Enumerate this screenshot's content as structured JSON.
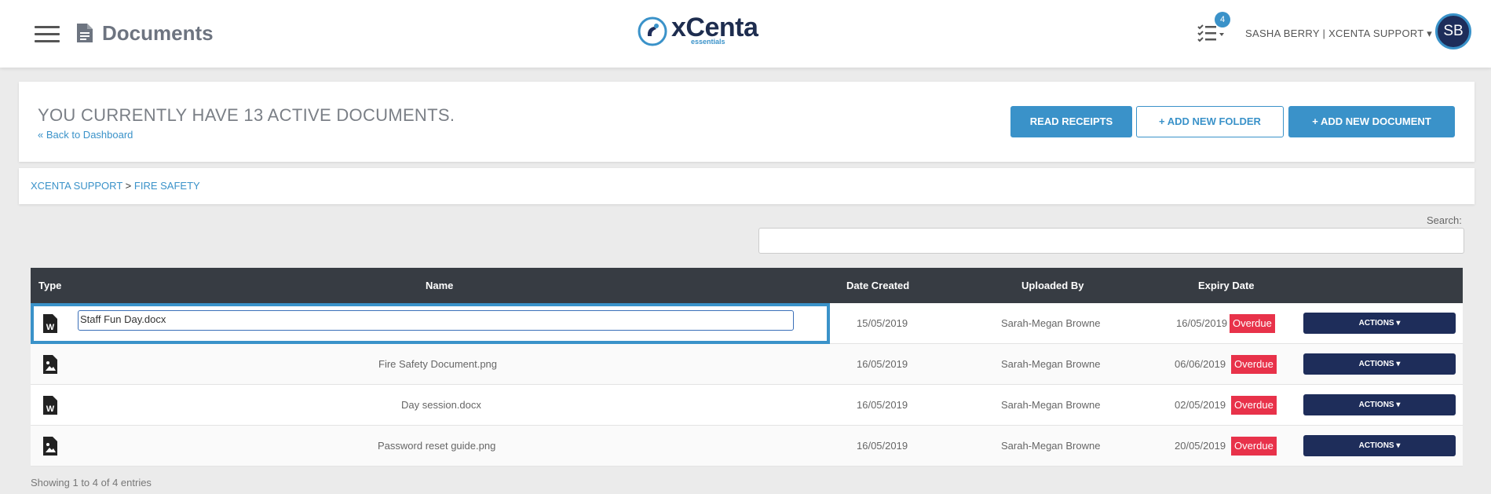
{
  "header": {
    "page_title": "Documents",
    "logo_text": "xCenta",
    "logo_sub": "essentials",
    "task_badge": "4",
    "user_menu": "SASHA BERRY | XCENTA SUPPORT ▾",
    "avatar_initials": "SB"
  },
  "summary": {
    "headline": "YOU CURRENTLY HAVE 13 ACTIVE DOCUMENTS.",
    "back_link": "« Back to Dashboard",
    "read_receipts": "READ RECEIPTS",
    "add_folder": "+ ADD NEW FOLDER",
    "add_document": "+ ADD NEW DOCUMENT"
  },
  "breadcrumb": {
    "root": "XCENTA SUPPORT",
    "separator": ">",
    "current": "FIRE SAFETY"
  },
  "search": {
    "label": "Search:",
    "value": ""
  },
  "table": {
    "columns": [
      "Type",
      "Name",
      "Date Created",
      "Uploaded By",
      "Expiry Date"
    ],
    "rows": [
      {
        "type_icon": "word-doc-icon",
        "name": "Staff Fun Day.docx",
        "created": "15/05/2019",
        "uploaded_by": "Sarah-Megan Browne",
        "expiry": "16/05/2019",
        "status": "Overdue",
        "actions": "ACTIONS ▾",
        "editing": true
      },
      {
        "type_icon": "image-file-icon",
        "name": "Fire Safety Document.png",
        "created": "16/05/2019",
        "uploaded_by": "Sarah-Megan Browne",
        "expiry": "06/06/2019",
        "status": "Overdue",
        "actions": "ACTIONS ▾"
      },
      {
        "type_icon": "word-doc-icon",
        "name": "Day session.docx",
        "created": "16/05/2019",
        "uploaded_by": "Sarah-Megan Browne",
        "expiry": "02/05/2019",
        "status": "Overdue",
        "actions": "ACTIONS ▾"
      },
      {
        "type_icon": "image-file-icon",
        "name": "Password reset guide.png",
        "created": "16/05/2019",
        "uploaded_by": "Sarah-Megan Browne",
        "expiry": "20/05/2019",
        "status": "Overdue",
        "actions": "ACTIONS ▾"
      }
    ]
  },
  "footer": {
    "info": "Showing 1 to 4 of 4 entries"
  },
  "colors": {
    "accent": "#3a92c9",
    "navy": "#1e2d5a",
    "overdue": "#e8324a",
    "table_header": "#373c43"
  }
}
